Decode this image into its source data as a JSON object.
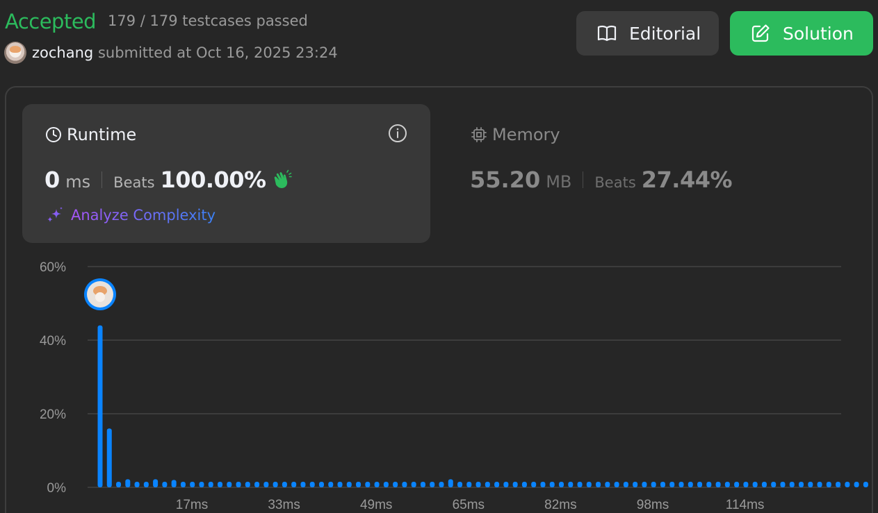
{
  "header": {
    "status": "Accepted",
    "testcases": "179 / 179 testcases passed",
    "username": "zochang",
    "submitted": "submitted at Oct 16, 2025 23:24",
    "editorial_label": "Editorial",
    "solution_label": "Solution"
  },
  "runtime": {
    "title": "Runtime",
    "value": "0",
    "unit": "ms",
    "beats_label": "Beats",
    "beats": "100.00%",
    "analyze_label": "Analyze Complexity"
  },
  "memory": {
    "title": "Memory",
    "value": "55.20",
    "unit": "MB",
    "beats_label": "Beats",
    "beats": "27.44%"
  },
  "colors": {
    "accepted": "#2cbb5d",
    "bar": "#0a84ff",
    "solution_button": "#2cbb5d"
  },
  "chart_data": {
    "type": "bar",
    "title": "",
    "xlabel": "",
    "ylabel": "",
    "ylim": [
      0,
      60
    ],
    "y_ticks": [
      "60%",
      "40%",
      "20%",
      "0%"
    ],
    "x_ticks": [
      "17ms",
      "33ms",
      "49ms",
      "65ms",
      "82ms",
      "98ms",
      "114ms"
    ],
    "grid": true,
    "highlighted_bar_index": 0,
    "values": [
      44,
      16,
      1.5,
      2.2,
      1.5,
      1.5,
      2.2,
      1.5,
      2.0,
      1.5,
      1.5,
      1.5,
      1.5,
      1.5,
      1.5,
      1.5,
      1.5,
      1.5,
      1.5,
      1.5,
      1.5,
      1.5,
      1.5,
      1.5,
      1.5,
      1.5,
      1.5,
      1.5,
      1.5,
      1.5,
      1.5,
      1.5,
      1.5,
      1.5,
      1.5,
      1.5,
      1.5,
      1.5,
      2.2,
      1.5,
      1.5,
      1.5,
      1.5,
      1.5,
      1.5,
      1.5,
      1.5,
      1.5,
      1.5,
      1.5,
      1.5,
      1.5,
      1.5,
      1.5,
      1.5,
      1.5,
      1.5,
      1.5,
      1.5,
      1.5,
      1.5,
      1.5,
      1.5,
      1.5,
      1.5,
      1.5,
      1.5,
      1.5,
      1.5,
      1.5,
      1.5,
      1.5,
      1.5,
      1.5,
      1.5,
      1.5,
      1.5,
      1.5,
      1.5,
      1.5,
      1.5,
      1.5,
      1.5,
      1.5
    ]
  }
}
